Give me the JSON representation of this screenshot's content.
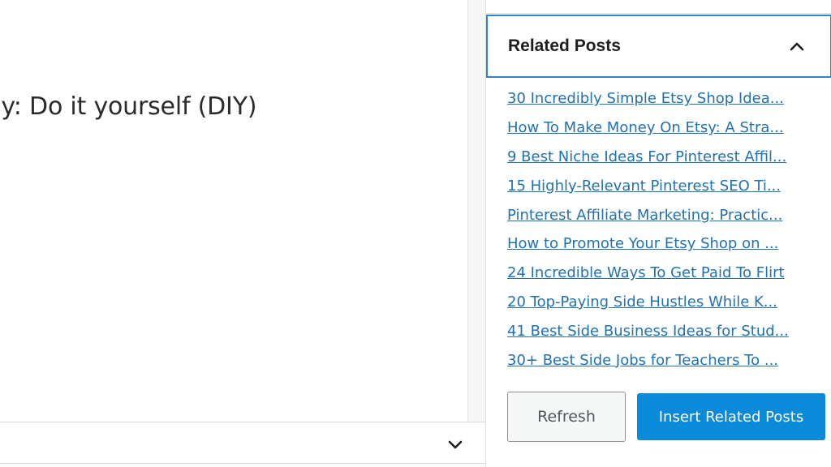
{
  "editor": {
    "heading_text": "sy: Do it yourself (DIY)"
  },
  "bottom_bar": {
    "toggle_icon": "chevron-down-icon"
  },
  "sidebar": {
    "panel_title": "Related Posts",
    "panel_toggle_icon": "chevron-up-icon",
    "posts": [
      "30 Incredibly Simple Etsy Shop Idea...",
      "How To Make Money On Etsy: A Stra...",
      "9 Best Niche Ideas For Pinterest Affil...",
      "15 Highly-Relevant Pinterest SEO Ti...",
      "Pinterest Affiliate Marketing: Practic...",
      "How to Promote Your Etsy Shop on ...",
      "24 Incredible Ways To Get Paid To Flirt",
      "20 Top-Paying Side Hustles While K...",
      "41 Best Side Business Ideas for Stud...",
      "30+ Best Side Jobs for Teachers To ..."
    ],
    "refresh_label": "Refresh",
    "insert_label": "Insert Related Posts"
  },
  "colors": {
    "link": "#2271b1",
    "panel_border": "#3582c4",
    "primary_button": "#0a8ad8"
  }
}
